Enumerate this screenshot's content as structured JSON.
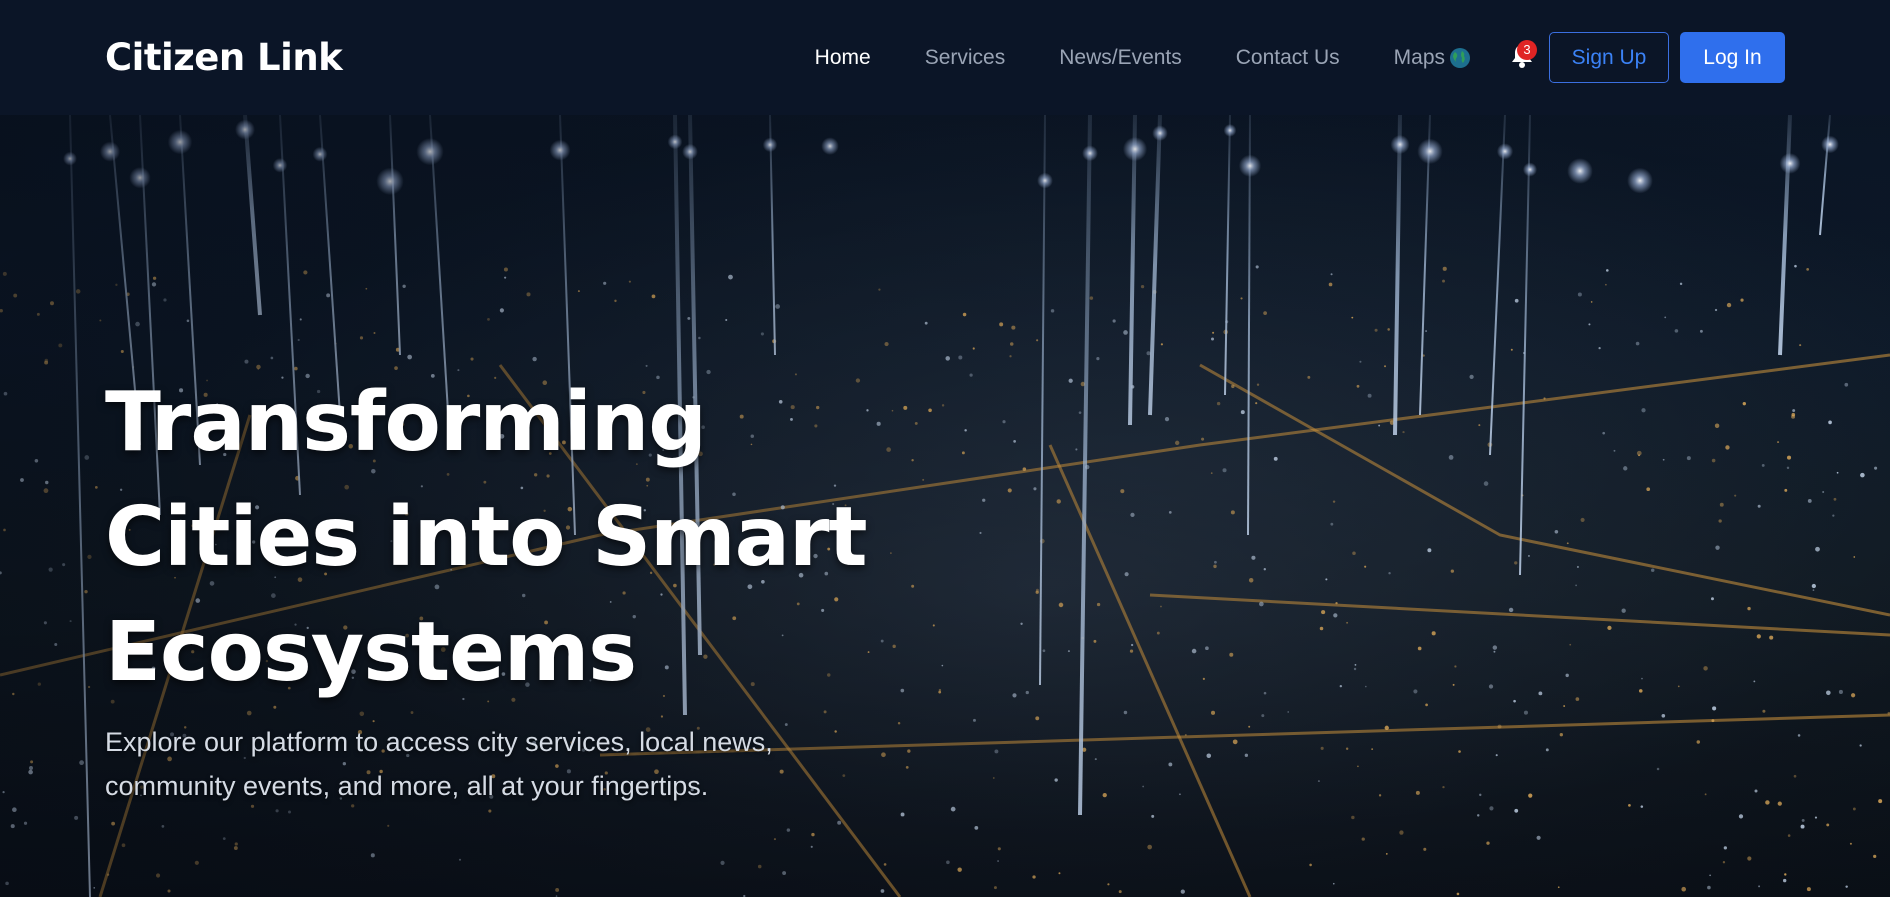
{
  "brand": {
    "name": "Citizen Link"
  },
  "nav": {
    "items": [
      {
        "label": "Home",
        "active": true
      },
      {
        "label": "Services",
        "active": false
      },
      {
        "label": "News/Events",
        "active": false
      },
      {
        "label": "Contact Us",
        "active": false
      },
      {
        "label": "Maps",
        "active": false,
        "icon": "globe-icon"
      }
    ],
    "notifications": {
      "icon": "bell-icon",
      "count": "3"
    },
    "signup_label": "Sign Up",
    "login_label": "Log In"
  },
  "hero": {
    "title": "Transforming Cities into Smart Ecosystems",
    "subtitle": "Explore our platform to access city services, local news, community events, and more, all at your fingertips.",
    "background": "night-city-aerial-image"
  },
  "colors": {
    "navbar_bg": "#0b1527",
    "accent": "#2f6fed",
    "badge": "#e02424",
    "nav_text": "#9aa4b5"
  }
}
